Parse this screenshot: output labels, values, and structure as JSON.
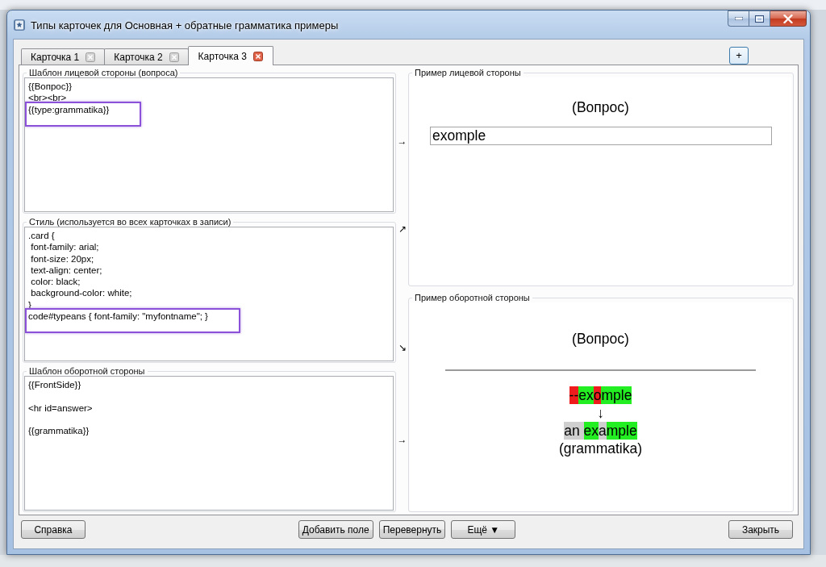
{
  "window": {
    "title": "Типы карточек для Основная + обратные грамматика примеры"
  },
  "tabs": [
    {
      "label": "Карточка 1",
      "selected": false
    },
    {
      "label": "Карточка 2",
      "selected": false
    },
    {
      "label": "Карточка 3",
      "selected": true
    }
  ],
  "add_tab_button": "+",
  "editors": [
    {
      "title": "Шаблон лицевой стороны (вопроса)",
      "blocks": [
        {
          "text": "{{Вопрос}}\n<br><br>",
          "highlighted": false
        },
        {
          "text": "{{type:grammatika}}",
          "highlighted": true
        }
      ],
      "arrows": [
        "→"
      ]
    },
    {
      "title": "Стиль (используется во всех карточках в записи)",
      "blocks": [
        {
          "text": ".card {\n font-family: arial;\n font-size: 20px;\n text-align: center;\n color: black;\n background-color: white;\n}",
          "highlighted": false
        },
        {
          "text": "code#typeans { font-family: \"myfontname\"; }",
          "highlighted": true
        }
      ],
      "arrows": [
        "↗",
        "↘"
      ]
    },
    {
      "title": "Шаблон оборотной стороны",
      "blocks": [
        {
          "text": "{{FrontSide}}\n\n<hr id=answer>\n\n{{grammatika}}",
          "highlighted": false
        }
      ],
      "arrows": [
        "→"
      ]
    }
  ],
  "front_preview": {
    "title": "Пример лицевой стороны",
    "question": "(Вопрос)",
    "answer_input": "exomple"
  },
  "back_preview": {
    "title": "Пример оборотной стороны",
    "question": "(Вопрос)",
    "typed": [
      {
        "text": "--",
        "kind": "bad"
      },
      {
        "text": "ex",
        "kind": "good"
      },
      {
        "text": "o",
        "kind": "bad"
      },
      {
        "text": "mple",
        "kind": "good"
      }
    ],
    "arrow": "↓",
    "expected": [
      {
        "text": "an ",
        "kind": "missed"
      },
      {
        "text": "ex",
        "kind": "good"
      },
      {
        "text": "a",
        "kind": "missed"
      },
      {
        "text": "mple",
        "kind": "good"
      }
    ],
    "field": "(grammatika)"
  },
  "buttons": {
    "left": [
      "Справка"
    ],
    "center": [
      "Добавить поле",
      "Перевернуть",
      "Ещё ▼"
    ],
    "right": [
      "Закрыть"
    ]
  }
}
